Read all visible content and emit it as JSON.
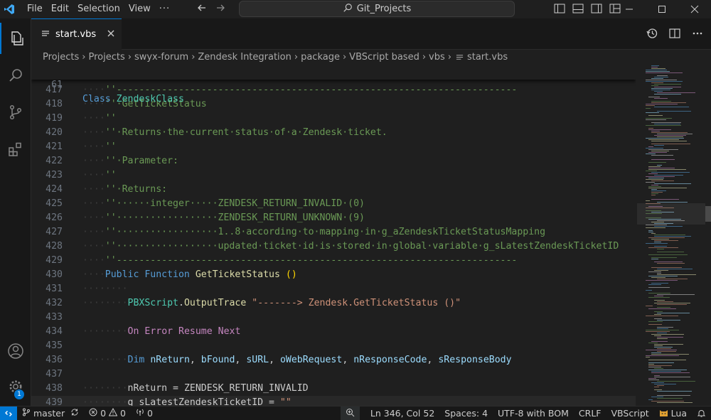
{
  "menu": [
    "File",
    "Edit",
    "Selection",
    "View",
    "···"
  ],
  "search": {
    "text": "Git_Projects"
  },
  "tab": {
    "label": "start.vbs"
  },
  "breadcrumb": [
    "Projects",
    "Projects",
    "swyx-forum",
    "Zendesk Integration",
    "package",
    "VBScript based",
    "vbs",
    "start.vbs"
  ],
  "editor": {
    "sticky": {
      "num": "61",
      "kw": "Class",
      "name": "ZendeskClass"
    },
    "lines": [
      {
        "num": "417",
        "ind": "····",
        "parts": [
          {
            "t": "''-----------------------------------------------------------------------",
            "c": "cm"
          }
        ]
      },
      {
        "num": "418",
        "ind": "····",
        "parts": [
          {
            "t": "''·GetTicketStatus",
            "c": "cm"
          }
        ]
      },
      {
        "num": "419",
        "ind": "····",
        "parts": [
          {
            "t": "''",
            "c": "cm"
          }
        ]
      },
      {
        "num": "420",
        "ind": "····",
        "parts": [
          {
            "t": "''·Returns·the·current·status·of·a·Zendesk·ticket.",
            "c": "cm"
          }
        ]
      },
      {
        "num": "421",
        "ind": "····",
        "parts": [
          {
            "t": "''",
            "c": "cm"
          }
        ]
      },
      {
        "num": "422",
        "ind": "····",
        "parts": [
          {
            "t": "''·Parameter:",
            "c": "cm"
          }
        ]
      },
      {
        "num": "423",
        "ind": "····",
        "parts": [
          {
            "t": "''",
            "c": "cm"
          }
        ]
      },
      {
        "num": "424",
        "ind": "····",
        "parts": [
          {
            "t": "''·Returns:",
            "c": "cm"
          }
        ]
      },
      {
        "num": "425",
        "ind": "····",
        "parts": [
          {
            "t": "''······integer·····ZENDESK_RETURN_INVALID·(0)",
            "c": "cm"
          }
        ]
      },
      {
        "num": "426",
        "ind": "····",
        "parts": [
          {
            "t": "''··················ZENDESK_RETURN_UNKNOWN·(9)",
            "c": "cm"
          }
        ]
      },
      {
        "num": "427",
        "ind": "····",
        "parts": [
          {
            "t": "''··················1..8·according·to·mapping·in·g_aZendeskTicketStatusMapping",
            "c": "cm"
          }
        ]
      },
      {
        "num": "428",
        "ind": "····",
        "parts": [
          {
            "t": "''··················updated·ticket·id·is·stored·in·global·variable·g_sLatestZendeskTicketID",
            "c": "cm"
          }
        ]
      },
      {
        "num": "429",
        "ind": "····",
        "parts": [
          {
            "t": "''-----------------------------------------------------------------------",
            "c": "cm"
          }
        ]
      },
      {
        "num": "430",
        "ind": "····",
        "parts": [
          {
            "t": "Public",
            "c": "kw"
          },
          {
            "t": " ",
            "c": ""
          },
          {
            "t": "Function",
            "c": "kw"
          },
          {
            "t": " ",
            "c": ""
          },
          {
            "t": "GetTicketStatus",
            "c": "fn"
          },
          {
            "t": " ",
            "c": ""
          },
          {
            "t": "()",
            "c": "par"
          }
        ]
      },
      {
        "num": "431",
        "ind": "········",
        "parts": []
      },
      {
        "num": "432",
        "ind": "········",
        "parts": [
          {
            "t": "PBXScript",
            "c": "cls"
          },
          {
            "t": ".",
            "c": ""
          },
          {
            "t": "OutputTrace",
            "c": "fn"
          },
          {
            "t": " ",
            "c": ""
          },
          {
            "t": "\"-------> Zendesk.GetTicketStatus ()\"",
            "c": "str"
          }
        ]
      },
      {
        "num": "433",
        "ind": "",
        "parts": []
      },
      {
        "num": "434",
        "ind": "········",
        "parts": [
          {
            "t": "On",
            "c": "kw2"
          },
          {
            "t": " ",
            "c": ""
          },
          {
            "t": "Error",
            "c": "kw2"
          },
          {
            "t": " ",
            "c": ""
          },
          {
            "t": "Resume",
            "c": "kw2"
          },
          {
            "t": " ",
            "c": ""
          },
          {
            "t": "Next",
            "c": "kw2"
          }
        ]
      },
      {
        "num": "435",
        "ind": "",
        "parts": []
      },
      {
        "num": "436",
        "ind": "········",
        "parts": [
          {
            "t": "Dim",
            "c": "kw"
          },
          {
            "t": " ",
            "c": ""
          },
          {
            "t": "nReturn",
            "c": "var"
          },
          {
            "t": ", ",
            "c": ""
          },
          {
            "t": "bFound",
            "c": "var"
          },
          {
            "t": ", ",
            "c": ""
          },
          {
            "t": "sURL",
            "c": "var"
          },
          {
            "t": ", ",
            "c": ""
          },
          {
            "t": "oWebRequest",
            "c": "var"
          },
          {
            "t": ", ",
            "c": ""
          },
          {
            "t": "nResponseCode",
            "c": "var"
          },
          {
            "t": ", ",
            "c": ""
          },
          {
            "t": "sResponseBody",
            "c": "var"
          }
        ]
      },
      {
        "num": "437",
        "ind": "",
        "parts": []
      },
      {
        "num": "438",
        "ind": "········",
        "parts": [
          {
            "t": "nReturn",
            "c": ""
          },
          {
            "t": " = ",
            "c": ""
          },
          {
            "t": "ZENDESK_RETURN_INVALID",
            "c": ""
          }
        ]
      },
      {
        "num": "439",
        "ind": "········",
        "parts": [
          {
            "t": "g_sLatestZendeskTicketID",
            "c": ""
          },
          {
            "t": " = ",
            "c": ""
          },
          {
            "t": "\"\"",
            "c": "str"
          }
        ]
      }
    ]
  },
  "status": {
    "branch": "master",
    "errors": "0",
    "warnings": "0",
    "ports": "0",
    "position": "Ln 346, Col 52",
    "spaces": "Spaces: 4",
    "encoding": "UTF-8 with BOM",
    "eol": "CRLF",
    "language": "VBScript",
    "lua": "Lua"
  },
  "settings_badge": "1",
  "colors": {
    "accent": "#0078d4",
    "comment": "#6a9955",
    "keyword": "#569cd6"
  }
}
